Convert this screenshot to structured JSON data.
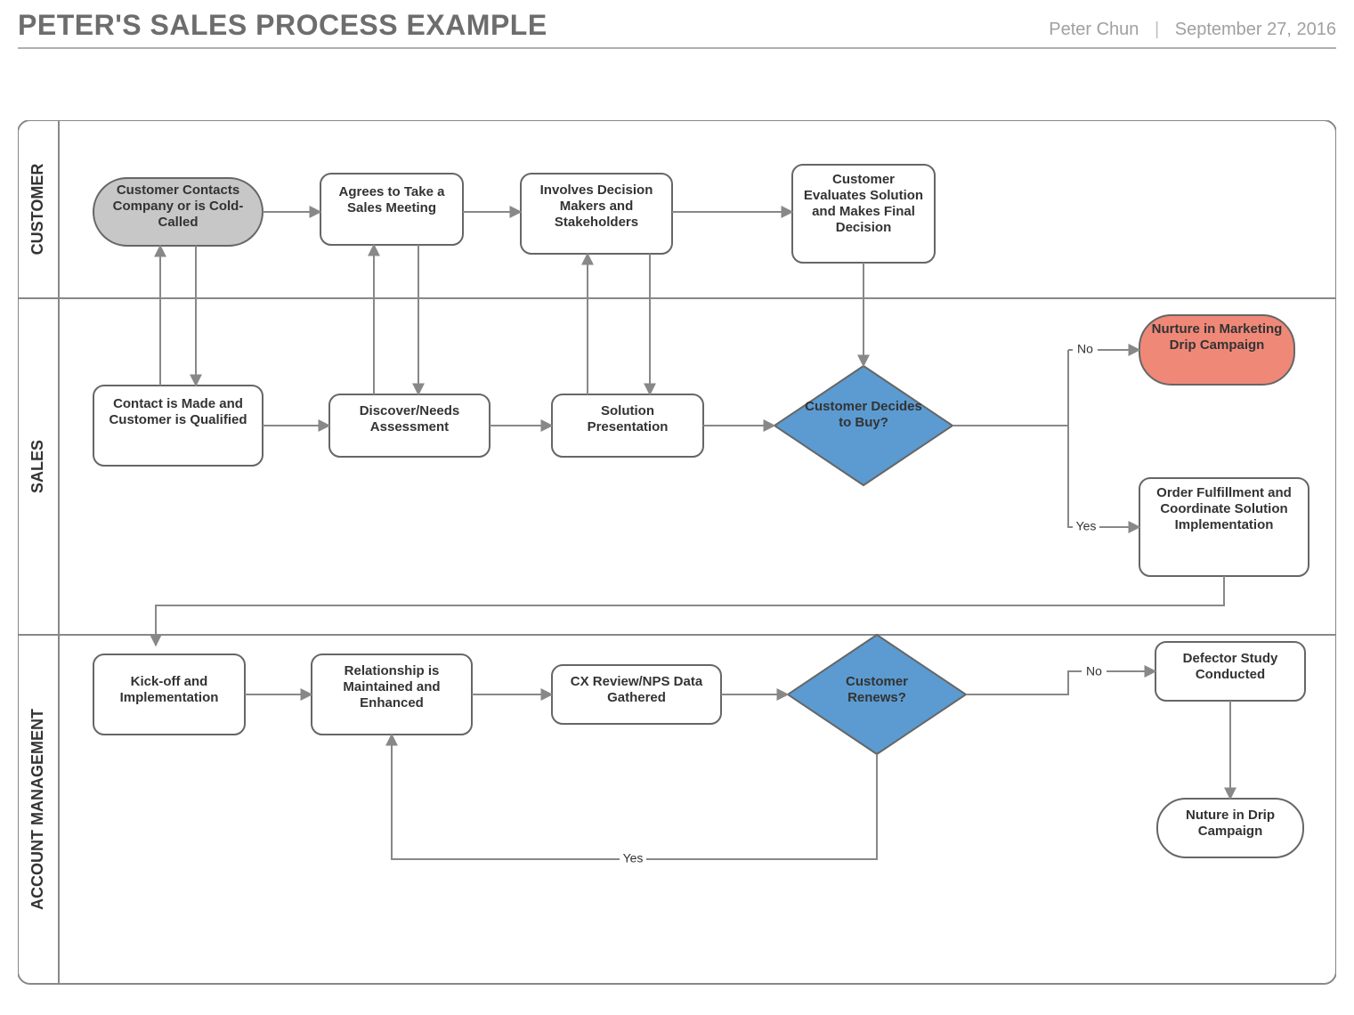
{
  "header": {
    "title": "PETER'S SALES PROCESS EXAMPLE",
    "author": "Peter Chun",
    "date": "September 27, 2016"
  },
  "lanes": {
    "customer": "CUSTOMER",
    "sales": "SALES",
    "acct": "ACCOUNT MANAGEMENT"
  },
  "nodes": {
    "start": "Customer Contacts Company or is Cold-Called",
    "agree": "Agrees to Take a Sales Meeting",
    "involve": "Involves Decision Makers and Stakeholders",
    "eval": "Customer Evaluates Solution and Makes Final Decision",
    "contact": "Contact is Made and Customer is Qualified",
    "discover": "Discover/Needs Assessment",
    "solution": "Solution Presentation",
    "decide": "Customer Decides to Buy?",
    "nurture": "Nurture in Marketing Drip Campaign",
    "order": "Order Fulfillment and Coordinate Solution Implementation",
    "kickoff": "Kick-off and Implementation",
    "relationship": "Relationship is Maintained and Enhanced",
    "cx": "CX Review/NPS Data Gathered",
    "renew": "Customer Renews?",
    "defector": "Defector Study Conducted",
    "drip2": "Nuture in Drip Campaign"
  },
  "edges": {
    "no1": "No",
    "yes1": "Yes",
    "no2": "No",
    "yes2": "Yes"
  }
}
